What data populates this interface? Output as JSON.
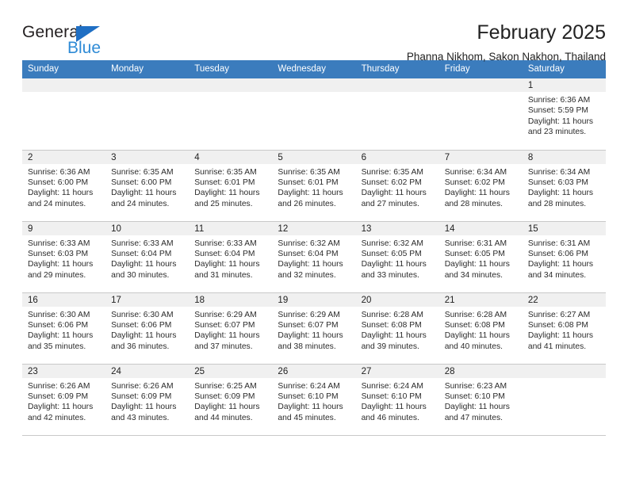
{
  "logo": {
    "word_top": "General",
    "word_bottom": "Blue",
    "triangle_icon": "triangle-icon",
    "accent_dark": "#1f6fc4",
    "accent_light": "#2f8bd6"
  },
  "header": {
    "title": "February 2025",
    "subtitle": "Phanna Nikhom, Sakon Nakhon, Thailand"
  },
  "theme": {
    "header_bg": "#3b7cbd",
    "header_text": "#ffffff",
    "daynum_bg": "#f0f0f0",
    "grid_line": "#c9c9c9"
  },
  "weekdays": [
    "Sunday",
    "Monday",
    "Tuesday",
    "Wednesday",
    "Thursday",
    "Friday",
    "Saturday"
  ],
  "weeks": [
    [
      {
        "day": "",
        "lines": []
      },
      {
        "day": "",
        "lines": []
      },
      {
        "day": "",
        "lines": []
      },
      {
        "day": "",
        "lines": []
      },
      {
        "day": "",
        "lines": []
      },
      {
        "day": "",
        "lines": []
      },
      {
        "day": "1",
        "lines": [
          "Sunrise: 6:36 AM",
          "Sunset: 5:59 PM",
          "Daylight: 11 hours",
          "and 23 minutes."
        ]
      }
    ],
    [
      {
        "day": "2",
        "lines": [
          "Sunrise: 6:36 AM",
          "Sunset: 6:00 PM",
          "Daylight: 11 hours",
          "and 24 minutes."
        ]
      },
      {
        "day": "3",
        "lines": [
          "Sunrise: 6:35 AM",
          "Sunset: 6:00 PM",
          "Daylight: 11 hours",
          "and 24 minutes."
        ]
      },
      {
        "day": "4",
        "lines": [
          "Sunrise: 6:35 AM",
          "Sunset: 6:01 PM",
          "Daylight: 11 hours",
          "and 25 minutes."
        ]
      },
      {
        "day": "5",
        "lines": [
          "Sunrise: 6:35 AM",
          "Sunset: 6:01 PM",
          "Daylight: 11 hours",
          "and 26 minutes."
        ]
      },
      {
        "day": "6",
        "lines": [
          "Sunrise: 6:35 AM",
          "Sunset: 6:02 PM",
          "Daylight: 11 hours",
          "and 27 minutes."
        ]
      },
      {
        "day": "7",
        "lines": [
          "Sunrise: 6:34 AM",
          "Sunset: 6:02 PM",
          "Daylight: 11 hours",
          "and 28 minutes."
        ]
      },
      {
        "day": "8",
        "lines": [
          "Sunrise: 6:34 AM",
          "Sunset: 6:03 PM",
          "Daylight: 11 hours",
          "and 28 minutes."
        ]
      }
    ],
    [
      {
        "day": "9",
        "lines": [
          "Sunrise: 6:33 AM",
          "Sunset: 6:03 PM",
          "Daylight: 11 hours",
          "and 29 minutes."
        ]
      },
      {
        "day": "10",
        "lines": [
          "Sunrise: 6:33 AM",
          "Sunset: 6:04 PM",
          "Daylight: 11 hours",
          "and 30 minutes."
        ]
      },
      {
        "day": "11",
        "lines": [
          "Sunrise: 6:33 AM",
          "Sunset: 6:04 PM",
          "Daylight: 11 hours",
          "and 31 minutes."
        ]
      },
      {
        "day": "12",
        "lines": [
          "Sunrise: 6:32 AM",
          "Sunset: 6:04 PM",
          "Daylight: 11 hours",
          "and 32 minutes."
        ]
      },
      {
        "day": "13",
        "lines": [
          "Sunrise: 6:32 AM",
          "Sunset: 6:05 PM",
          "Daylight: 11 hours",
          "and 33 minutes."
        ]
      },
      {
        "day": "14",
        "lines": [
          "Sunrise: 6:31 AM",
          "Sunset: 6:05 PM",
          "Daylight: 11 hours",
          "and 34 minutes."
        ]
      },
      {
        "day": "15",
        "lines": [
          "Sunrise: 6:31 AM",
          "Sunset: 6:06 PM",
          "Daylight: 11 hours",
          "and 34 minutes."
        ]
      }
    ],
    [
      {
        "day": "16",
        "lines": [
          "Sunrise: 6:30 AM",
          "Sunset: 6:06 PM",
          "Daylight: 11 hours",
          "and 35 minutes."
        ]
      },
      {
        "day": "17",
        "lines": [
          "Sunrise: 6:30 AM",
          "Sunset: 6:06 PM",
          "Daylight: 11 hours",
          "and 36 minutes."
        ]
      },
      {
        "day": "18",
        "lines": [
          "Sunrise: 6:29 AM",
          "Sunset: 6:07 PM",
          "Daylight: 11 hours",
          "and 37 minutes."
        ]
      },
      {
        "day": "19",
        "lines": [
          "Sunrise: 6:29 AM",
          "Sunset: 6:07 PM",
          "Daylight: 11 hours",
          "and 38 minutes."
        ]
      },
      {
        "day": "20",
        "lines": [
          "Sunrise: 6:28 AM",
          "Sunset: 6:08 PM",
          "Daylight: 11 hours",
          "and 39 minutes."
        ]
      },
      {
        "day": "21",
        "lines": [
          "Sunrise: 6:28 AM",
          "Sunset: 6:08 PM",
          "Daylight: 11 hours",
          "and 40 minutes."
        ]
      },
      {
        "day": "22",
        "lines": [
          "Sunrise: 6:27 AM",
          "Sunset: 6:08 PM",
          "Daylight: 11 hours",
          "and 41 minutes."
        ]
      }
    ],
    [
      {
        "day": "23",
        "lines": [
          "Sunrise: 6:26 AM",
          "Sunset: 6:09 PM",
          "Daylight: 11 hours",
          "and 42 minutes."
        ]
      },
      {
        "day": "24",
        "lines": [
          "Sunrise: 6:26 AM",
          "Sunset: 6:09 PM",
          "Daylight: 11 hours",
          "and 43 minutes."
        ]
      },
      {
        "day": "25",
        "lines": [
          "Sunrise: 6:25 AM",
          "Sunset: 6:09 PM",
          "Daylight: 11 hours",
          "and 44 minutes."
        ]
      },
      {
        "day": "26",
        "lines": [
          "Sunrise: 6:24 AM",
          "Sunset: 6:10 PM",
          "Daylight: 11 hours",
          "and 45 minutes."
        ]
      },
      {
        "day": "27",
        "lines": [
          "Sunrise: 6:24 AM",
          "Sunset: 6:10 PM",
          "Daylight: 11 hours",
          "and 46 minutes."
        ]
      },
      {
        "day": "28",
        "lines": [
          "Sunrise: 6:23 AM",
          "Sunset: 6:10 PM",
          "Daylight: 11 hours",
          "and 47 minutes."
        ]
      },
      {
        "day": "",
        "lines": []
      }
    ]
  ]
}
